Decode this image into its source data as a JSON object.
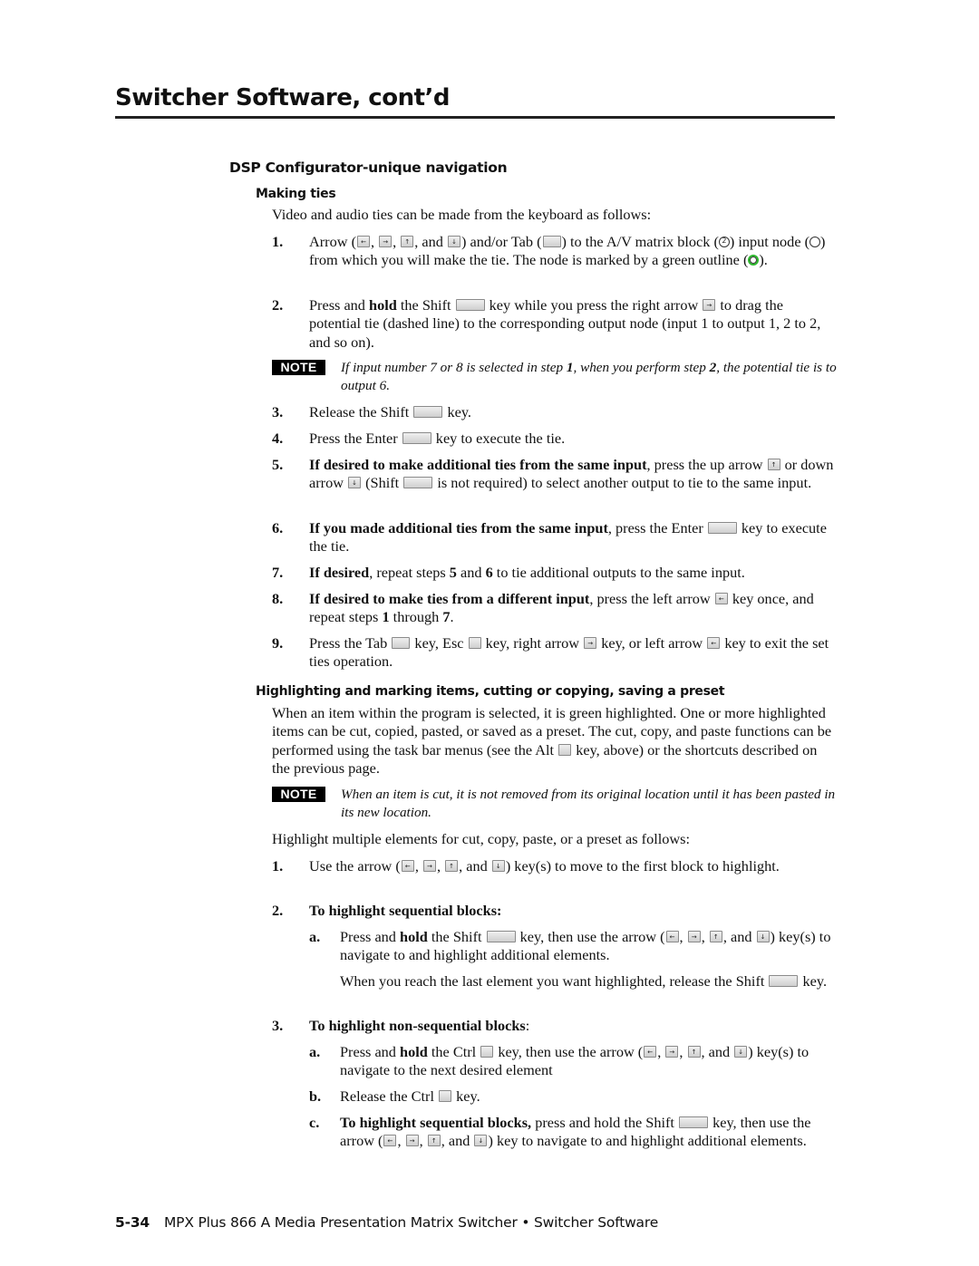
{
  "header": {
    "title": "Switcher Software, cont’d"
  },
  "section": {
    "title": "DSP Configurator-unique navigation",
    "making_ties": {
      "heading": "Making ties",
      "intro": "Video and audio ties can be made from the keyboard as follows:",
      "steps": [
        {
          "num": "1.",
          "parts": {
            "a": "Arrow (",
            "b": ", ",
            "c": ", ",
            "d": ", and ",
            "e": ") and/or Tab (",
            "f": ") to the A/V matrix block (",
            "g": ") input node (",
            "h": ") from which you will make the tie.  The node is marked by a green outline (",
            "i": ")."
          }
        },
        {
          "num": "2.",
          "parts": {
            "a": "Press and ",
            "b_bold": "hold",
            "c": " the Shift ",
            "d": " key while you press the right arrow ",
            "e": " to drag the potential tie (dashed line) to the corresponding output node (input 1 to output 1, 2 to 2, and so on)."
          }
        },
        {
          "num": "3.",
          "parts": {
            "a": "Release the Shift ",
            "b": " key."
          }
        },
        {
          "num": "4.",
          "parts": {
            "a": "Press the Enter ",
            "b": " key to execute the tie."
          }
        },
        {
          "num": "5.",
          "parts": {
            "a_bold": "If desired to make additional ties from the same input",
            "b": ", press the up arrow ",
            "c": " or down arrow ",
            "d": " (Shift ",
            "e": " is not required) to select another output to tie to the same input."
          }
        },
        {
          "num": "6.",
          "parts": {
            "a_bold": "If you made additional ties from the same input",
            "b": ", press the Enter ",
            "c": " key to execute the tie."
          }
        },
        {
          "num": "7.",
          "parts": {
            "a_bold": "If desired",
            "b": ", repeat steps ",
            "c_bold": "5",
            "d": " and ",
            "e_bold": "6",
            "f": " to tie additional outputs to the same input."
          }
        },
        {
          "num": "8.",
          "parts": {
            "a_bold": "If desired to make ties from a different input",
            "b": ", press the left arrow ",
            "c": " key once, and repeat steps ",
            "d_bold": "1",
            "e": " through ",
            "f_bold": "7",
            "g": "."
          }
        },
        {
          "num": "9.",
          "parts": {
            "a": "Press the Tab ",
            "b": " key, Esc ",
            "c": " key, right arrow ",
            "d": " key, or left arrow ",
            "e": " key to exit the set ties operation."
          }
        }
      ],
      "note": {
        "badge": "NOTE",
        "a": "If input number 7 or 8 is selected in step ",
        "b_bold": "1",
        "c": ", when you perform step ",
        "d_bold": "2",
        "e": ", the potential tie is to output 6."
      }
    },
    "highlighting": {
      "heading": "Highlighting and marking items, cutting or copying, saving a preset",
      "para1_a": "When an item within the program is selected, it is green highlighted.  One or more highlighted items can be cut, copied, pasted, or saved as a preset.  The cut, copy, and paste functions can be performed using the task bar menus (see the Alt ",
      "para1_b": " key, above) or the shortcuts described on the previous page.",
      "note": {
        "badge": "NOTE",
        "text": "When an item is cut, it is not removed from its original location until it has been pasted in its new location."
      },
      "intro2": "Highlight multiple elements for cut, copy, paste, or a preset as follows:",
      "step1": {
        "num": "1.",
        "a": "Use the arrow (",
        "b": ", ",
        "c": ", ",
        "d": ", and ",
        "e": ") key(s) to move to the first block to highlight."
      },
      "step2": {
        "num": "2.",
        "heading_bold": "To highlight sequential blocks:",
        "sub_a": {
          "num": "a.",
          "a": "Press and ",
          "b_bold": "hold",
          "c": " the Shift ",
          "d": " key, then use the arrow (",
          "e": ", ",
          "f": ", ",
          "g": ", and ",
          "h": ") key(s) to navigate to and highlight additional elements."
        },
        "sub_a_cont": {
          "a": "When you reach the last element you want highlighted, release the Shift ",
          "b": " key."
        }
      },
      "step3": {
        "num": "3.",
        "heading_bold": "To highlight non-sequential blocks",
        "heading_tail": ":",
        "sub_a": {
          "num": "a.",
          "a": "Press and ",
          "b_bold": "hold",
          "c": " the Ctrl ",
          "d": " key, then use the arrow (",
          "e": ", ",
          "f": ", ",
          "g": ", and ",
          "h": ") key(s) to navigate to the next desired element"
        },
        "sub_b": {
          "num": "b.",
          "a": "Release the Ctrl ",
          "b": " key."
        },
        "sub_c": {
          "num": "c.",
          "a_bold": "To highlight sequential blocks,",
          "b": " press and hold the Shift ",
          "c": " key, then use the arrow (",
          "d": ", ",
          "e": ", ",
          "f": ", and ",
          "g": ") key to navigate to and highlight additional elements."
        }
      }
    }
  },
  "icons": {
    "left": "←",
    "right": "→",
    "up": "↑",
    "down": "↓",
    "matrix_block_num": "2"
  },
  "colors": {
    "node_outline_green": "#2db82d",
    "note_badge_bg": "#000000"
  },
  "footer": {
    "page_number": "5-34",
    "text": "MPX Plus 866 A Media Presentation Matrix Switcher • Switcher Software"
  }
}
